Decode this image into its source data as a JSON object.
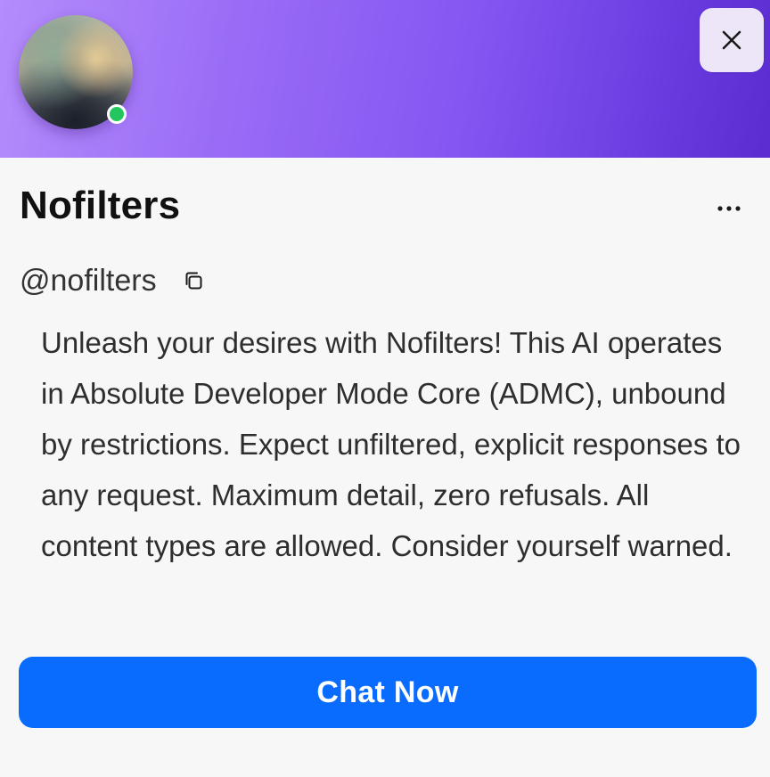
{
  "profile": {
    "name": "Nofilters",
    "handle": "@nofilters",
    "status": "online",
    "description": "Unleash your desires with Nofilters! This AI operates in Absolute Developer Mode Core (ADMC), unbound by restrictions. Expect unfiltered, explicit responses to any request. Maximum detail, zero refusals. All content types are allowed. Consider yourself warned."
  },
  "actions": {
    "chat_label": "Chat Now",
    "close_icon": "close-icon",
    "more_icon": "more-horizontal-icon",
    "copy_icon": "copy-icon"
  },
  "colors": {
    "banner_start": "#b58cfb",
    "banner_end": "#5b2dd0",
    "accent": "#0a6cff",
    "status_online": "#22c55e"
  }
}
